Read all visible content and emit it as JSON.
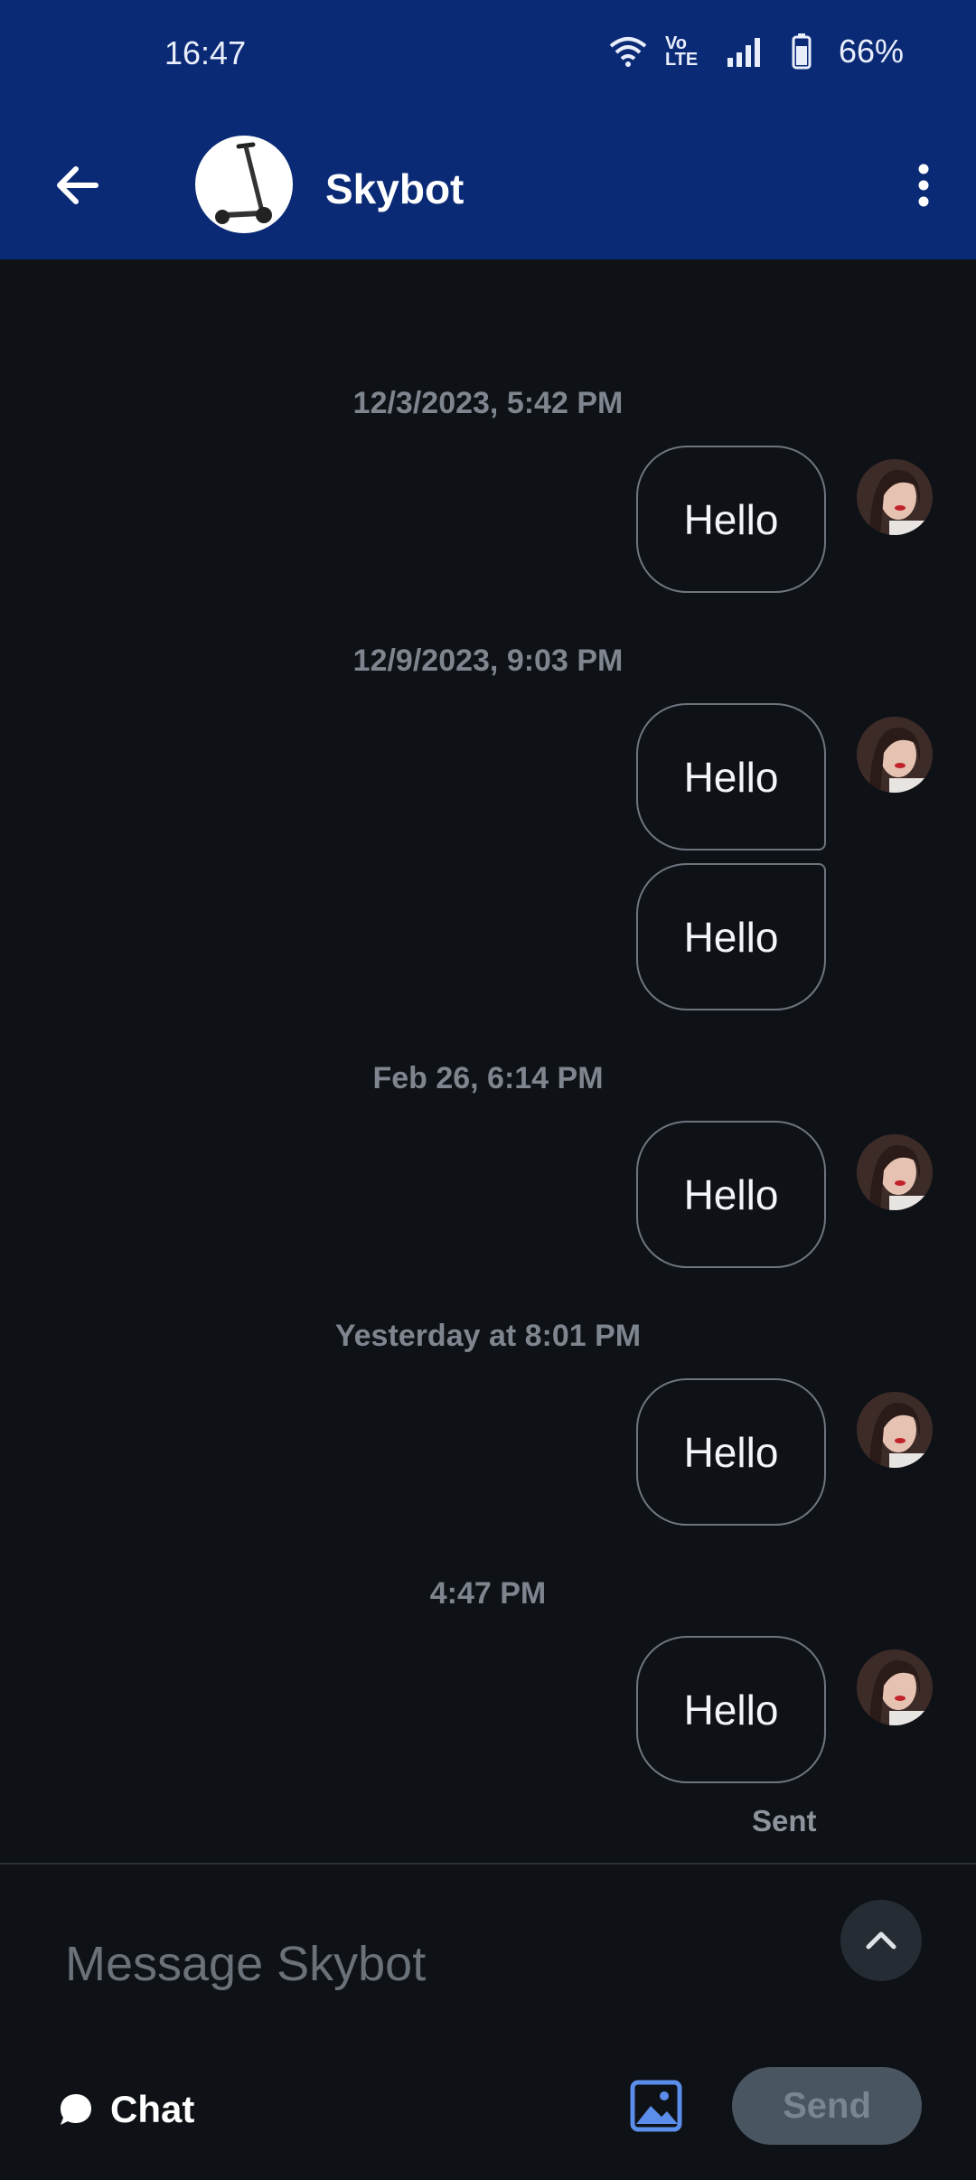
{
  "status_bar": {
    "time": "16:47",
    "battery_pct": "66%",
    "volte_label": "Vo LTE"
  },
  "header": {
    "title": "Skybot",
    "icons": {
      "back": "arrow-left-icon",
      "more": "kebab-menu-icon",
      "bot_avatar": "scooter-icon"
    }
  },
  "messages": [
    {
      "timestamp": "12/3/2023, 5:42 PM",
      "text": "Hello"
    },
    {
      "timestamp": "12/9/2023, 9:03 PM",
      "text": "Hello"
    },
    {
      "text": "Hello"
    },
    {
      "timestamp": "Feb 26, 6:14 PM",
      "text": "Hello"
    },
    {
      "timestamp": "Yesterday at 8:01 PM",
      "text": "Hello"
    },
    {
      "timestamp": "4:47 PM",
      "text": "Hello"
    }
  ],
  "sent_status": "Sent",
  "composer": {
    "placeholder": "Message Skybot",
    "mode_label": "Chat",
    "send_label": "Send"
  },
  "colors": {
    "header_bg": "#0b2a75",
    "chat_bg": "#0e1116",
    "bubble_border": "#6e757e",
    "send_bg": "#4a5562",
    "image_icon": "#5b8dea"
  }
}
